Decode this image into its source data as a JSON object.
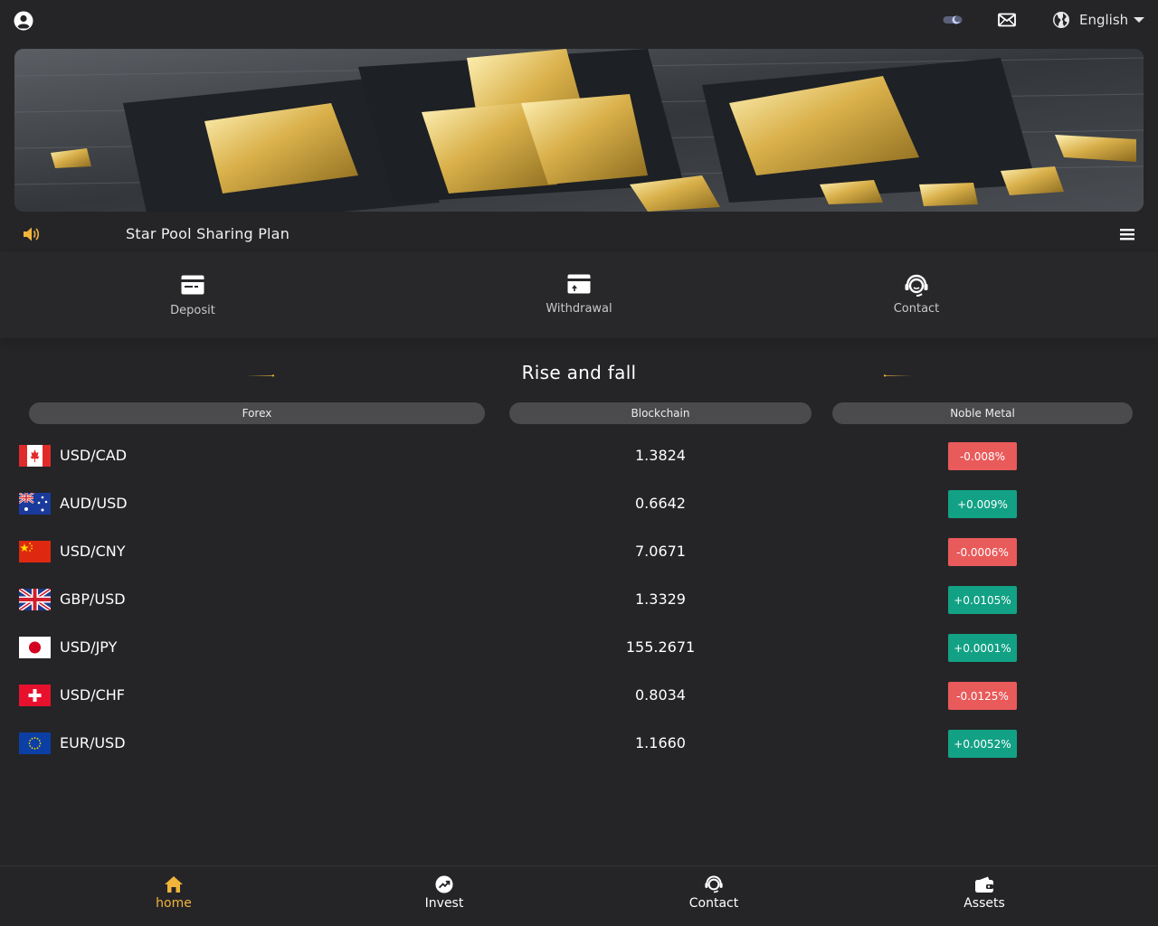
{
  "header": {
    "language": "English"
  },
  "notice": {
    "text": "Star Pool Sharing Plan"
  },
  "quick_actions": [
    {
      "label": "Deposit"
    },
    {
      "label": "Withdrawal"
    },
    {
      "label": "Contact"
    }
  ],
  "section": {
    "title": "Rise and fall"
  },
  "tabs": [
    {
      "label": "Forex"
    },
    {
      "label": "Blockchain"
    },
    {
      "label": "Noble Metal"
    }
  ],
  "quotes": [
    {
      "pair": "USD/CAD",
      "flag": "canada-flag",
      "price": "1.3824",
      "change": "-0.008%",
      "direction": "down"
    },
    {
      "pair": "AUD/USD",
      "flag": "australia-flag",
      "price": "0.6642",
      "change": "+0.009%",
      "direction": "up"
    },
    {
      "pair": "USD/CNY",
      "flag": "china-flag",
      "price": "7.0671",
      "change": "-0.0006%",
      "direction": "down"
    },
    {
      "pair": "GBP/USD",
      "flag": "uk-flag",
      "price": "1.3329",
      "change": "+0.0105%",
      "direction": "up"
    },
    {
      "pair": "USD/JPY",
      "flag": "japan-flag",
      "price": "155.2671",
      "change": "+0.0001%",
      "direction": "up"
    },
    {
      "pair": "USD/CHF",
      "flag": "switzerland-flag",
      "price": "0.8034",
      "change": "-0.0125%",
      "direction": "down"
    },
    {
      "pair": "EUR/USD",
      "flag": "eu-flag",
      "price": "1.1660",
      "change": "+0.0052%",
      "direction": "up"
    }
  ],
  "bottom_nav": [
    {
      "label": "home",
      "icon": "home-icon",
      "active": true
    },
    {
      "label": "Invest",
      "icon": "trend-icon",
      "active": false
    },
    {
      "label": "Contact",
      "icon": "support-icon",
      "active": false
    },
    {
      "label": "Assets",
      "icon": "wallet-icon",
      "active": false
    }
  ],
  "colors": {
    "background": "#252528",
    "accent": "#f0b43a",
    "up": "#12a185",
    "down": "#e95a5a",
    "tab": "#4b4b4e"
  }
}
